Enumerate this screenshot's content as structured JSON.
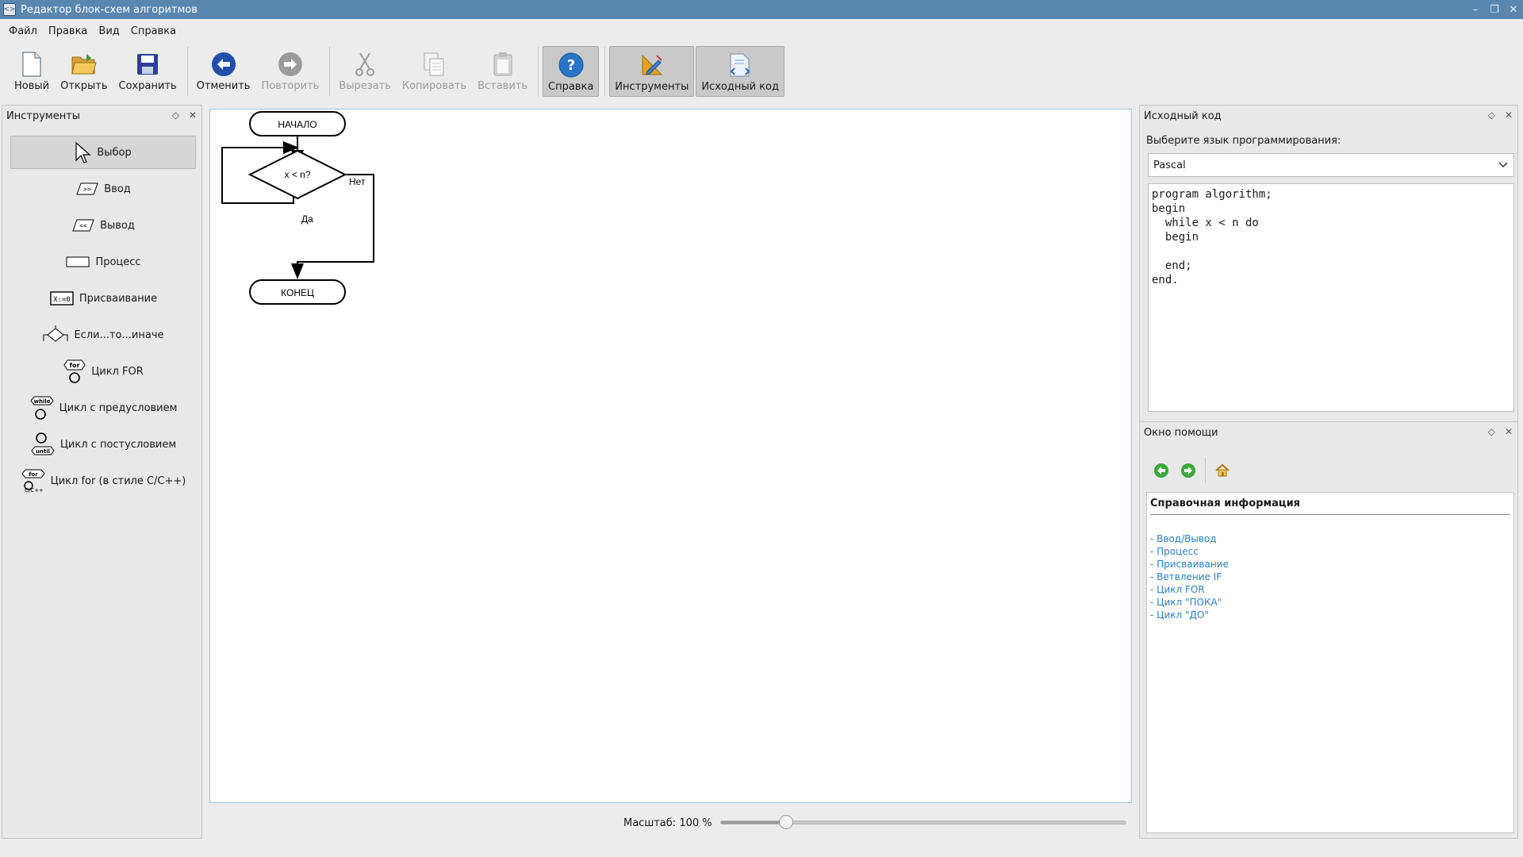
{
  "window": {
    "title": "Редактор блок-схем алгоритмов",
    "controls": [
      "–",
      "❐",
      "✕"
    ]
  },
  "menu": {
    "items": [
      "Файл",
      "Правка",
      "Вид",
      "Справка"
    ]
  },
  "toolbar": {
    "new": "Новый",
    "open": "Открыть",
    "save": "Сохранить",
    "undo": "Отменить",
    "redo": "Повторить",
    "cut": "Вырезать",
    "copy": "Копировать",
    "paste": "Вставить",
    "help": "Справка",
    "tools": "Инструменты",
    "source": "Исходный код"
  },
  "tools_panel": {
    "title": "Инструменты",
    "items": [
      {
        "label": "Выбор",
        "icon": "cursor-icon",
        "selected": true
      },
      {
        "label": "Ввод",
        "icon": "input-icon"
      },
      {
        "label": "Вывод",
        "icon": "output-icon"
      },
      {
        "label": "Процесс",
        "icon": "process-icon"
      },
      {
        "label": "Присваивание",
        "icon": "assign-icon"
      },
      {
        "label": "Если...то...иначе",
        "icon": "if-icon"
      },
      {
        "label": "Цикл FOR",
        "icon": "for-loop-icon"
      },
      {
        "label": "Цикл с предусловием",
        "icon": "while-loop-icon"
      },
      {
        "label": "Цикл с постусловием",
        "icon": "until-loop-icon"
      },
      {
        "label": "Цикл for (в стиле C/C++)",
        "icon": "c-for-loop-icon"
      }
    ]
  },
  "flowchart": {
    "start": "НАЧАЛО",
    "condition": "x < n?",
    "no": "Нет",
    "yes": "Да",
    "end": "КОНЕЦ"
  },
  "zoom": {
    "label": "Масштаб:",
    "value": "100 %",
    "level": 0.16
  },
  "source_panel": {
    "title": "Исходный код",
    "lang_label": "Выберите язык программирования:",
    "language": "Pascal",
    "code": "program algorithm;\nbegin\n  while x < n do\n  begin\n\n  end;\nend."
  },
  "help_panel": {
    "title": "Окно помощи",
    "heading": "Справочная информация",
    "links": [
      "- Ввод/Вывод",
      "- Процесс",
      "- Присваивание",
      "- Ветвление IF",
      "- Цикл FOR",
      "- Цикл \"ПОКА\"",
      "- Цикл \"ДО\""
    ]
  },
  "colors": {
    "titlebar": "#5a87b0",
    "link": "#2d7fc4",
    "canvas_border": "#9ec5e0"
  }
}
